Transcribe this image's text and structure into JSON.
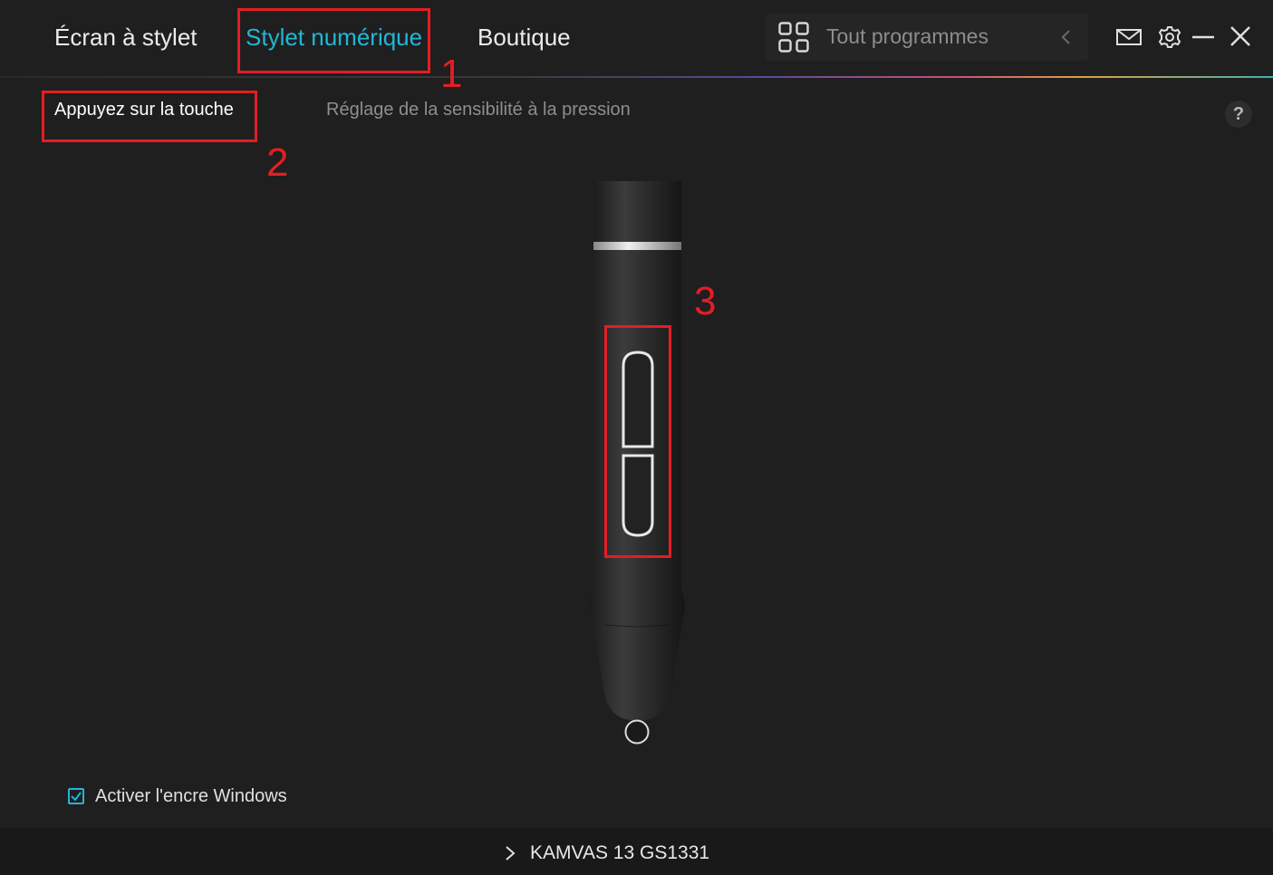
{
  "header": {
    "tabs": [
      {
        "label": "Écran à stylet",
        "active": false
      },
      {
        "label": "Stylet numérique",
        "active": true
      },
      {
        "label": "Boutique",
        "active": false
      }
    ],
    "program_selector": {
      "label": "Tout programmes",
      "icon": "grid-icon"
    },
    "window_controls": [
      "mail-icon",
      "gear-icon",
      "minimize-icon",
      "close-icon"
    ],
    "accent_color": "#22b6d6"
  },
  "subtabs": [
    {
      "label": "Appuyez sur la touche",
      "active": true
    },
    {
      "label": "Réglage de la sensibilité à la pression",
      "active": false
    }
  ],
  "help": {
    "label": "?"
  },
  "annotations": {
    "color": "#e31e24",
    "labels": [
      "1",
      "2",
      "3"
    ]
  },
  "windows_ink": {
    "label": "Activer l'encre Windows",
    "checked": true
  },
  "footer": {
    "device": "KAMVAS 13 GS1331"
  }
}
